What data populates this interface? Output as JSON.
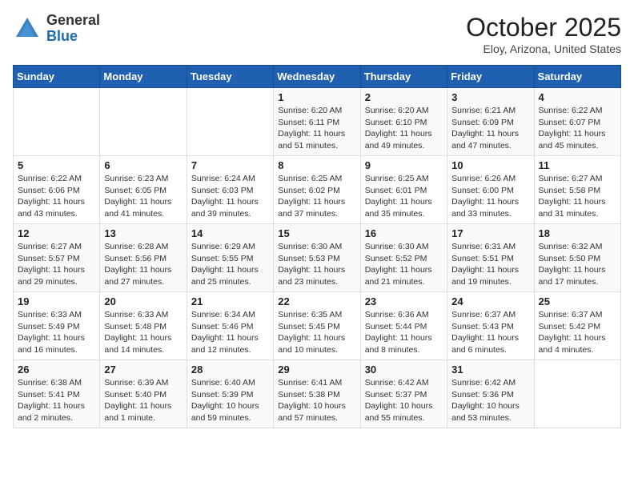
{
  "header": {
    "logo_general": "General",
    "logo_blue": "Blue",
    "month": "October 2025",
    "location": "Eloy, Arizona, United States"
  },
  "weekdays": [
    "Sunday",
    "Monday",
    "Tuesday",
    "Wednesday",
    "Thursday",
    "Friday",
    "Saturday"
  ],
  "weeks": [
    [
      {
        "day": "",
        "info": ""
      },
      {
        "day": "",
        "info": ""
      },
      {
        "day": "",
        "info": ""
      },
      {
        "day": "1",
        "info": "Sunrise: 6:20 AM\nSunset: 6:11 PM\nDaylight: 11 hours\nand 51 minutes."
      },
      {
        "day": "2",
        "info": "Sunrise: 6:20 AM\nSunset: 6:10 PM\nDaylight: 11 hours\nand 49 minutes."
      },
      {
        "day": "3",
        "info": "Sunrise: 6:21 AM\nSunset: 6:09 PM\nDaylight: 11 hours\nand 47 minutes."
      },
      {
        "day": "4",
        "info": "Sunrise: 6:22 AM\nSunset: 6:07 PM\nDaylight: 11 hours\nand 45 minutes."
      }
    ],
    [
      {
        "day": "5",
        "info": "Sunrise: 6:22 AM\nSunset: 6:06 PM\nDaylight: 11 hours\nand 43 minutes."
      },
      {
        "day": "6",
        "info": "Sunrise: 6:23 AM\nSunset: 6:05 PM\nDaylight: 11 hours\nand 41 minutes."
      },
      {
        "day": "7",
        "info": "Sunrise: 6:24 AM\nSunset: 6:03 PM\nDaylight: 11 hours\nand 39 minutes."
      },
      {
        "day": "8",
        "info": "Sunrise: 6:25 AM\nSunset: 6:02 PM\nDaylight: 11 hours\nand 37 minutes."
      },
      {
        "day": "9",
        "info": "Sunrise: 6:25 AM\nSunset: 6:01 PM\nDaylight: 11 hours\nand 35 minutes."
      },
      {
        "day": "10",
        "info": "Sunrise: 6:26 AM\nSunset: 6:00 PM\nDaylight: 11 hours\nand 33 minutes."
      },
      {
        "day": "11",
        "info": "Sunrise: 6:27 AM\nSunset: 5:58 PM\nDaylight: 11 hours\nand 31 minutes."
      }
    ],
    [
      {
        "day": "12",
        "info": "Sunrise: 6:27 AM\nSunset: 5:57 PM\nDaylight: 11 hours\nand 29 minutes."
      },
      {
        "day": "13",
        "info": "Sunrise: 6:28 AM\nSunset: 5:56 PM\nDaylight: 11 hours\nand 27 minutes."
      },
      {
        "day": "14",
        "info": "Sunrise: 6:29 AM\nSunset: 5:55 PM\nDaylight: 11 hours\nand 25 minutes."
      },
      {
        "day": "15",
        "info": "Sunrise: 6:30 AM\nSunset: 5:53 PM\nDaylight: 11 hours\nand 23 minutes."
      },
      {
        "day": "16",
        "info": "Sunrise: 6:30 AM\nSunset: 5:52 PM\nDaylight: 11 hours\nand 21 minutes."
      },
      {
        "day": "17",
        "info": "Sunrise: 6:31 AM\nSunset: 5:51 PM\nDaylight: 11 hours\nand 19 minutes."
      },
      {
        "day": "18",
        "info": "Sunrise: 6:32 AM\nSunset: 5:50 PM\nDaylight: 11 hours\nand 17 minutes."
      }
    ],
    [
      {
        "day": "19",
        "info": "Sunrise: 6:33 AM\nSunset: 5:49 PM\nDaylight: 11 hours\nand 16 minutes."
      },
      {
        "day": "20",
        "info": "Sunrise: 6:33 AM\nSunset: 5:48 PM\nDaylight: 11 hours\nand 14 minutes."
      },
      {
        "day": "21",
        "info": "Sunrise: 6:34 AM\nSunset: 5:46 PM\nDaylight: 11 hours\nand 12 minutes."
      },
      {
        "day": "22",
        "info": "Sunrise: 6:35 AM\nSunset: 5:45 PM\nDaylight: 11 hours\nand 10 minutes."
      },
      {
        "day": "23",
        "info": "Sunrise: 6:36 AM\nSunset: 5:44 PM\nDaylight: 11 hours\nand 8 minutes."
      },
      {
        "day": "24",
        "info": "Sunrise: 6:37 AM\nSunset: 5:43 PM\nDaylight: 11 hours\nand 6 minutes."
      },
      {
        "day": "25",
        "info": "Sunrise: 6:37 AM\nSunset: 5:42 PM\nDaylight: 11 hours\nand 4 minutes."
      }
    ],
    [
      {
        "day": "26",
        "info": "Sunrise: 6:38 AM\nSunset: 5:41 PM\nDaylight: 11 hours\nand 2 minutes."
      },
      {
        "day": "27",
        "info": "Sunrise: 6:39 AM\nSunset: 5:40 PM\nDaylight: 11 hours\nand 1 minute."
      },
      {
        "day": "28",
        "info": "Sunrise: 6:40 AM\nSunset: 5:39 PM\nDaylight: 10 hours\nand 59 minutes."
      },
      {
        "day": "29",
        "info": "Sunrise: 6:41 AM\nSunset: 5:38 PM\nDaylight: 10 hours\nand 57 minutes."
      },
      {
        "day": "30",
        "info": "Sunrise: 6:42 AM\nSunset: 5:37 PM\nDaylight: 10 hours\nand 55 minutes."
      },
      {
        "day": "31",
        "info": "Sunrise: 6:42 AM\nSunset: 5:36 PM\nDaylight: 10 hours\nand 53 minutes."
      },
      {
        "day": "",
        "info": ""
      }
    ]
  ]
}
